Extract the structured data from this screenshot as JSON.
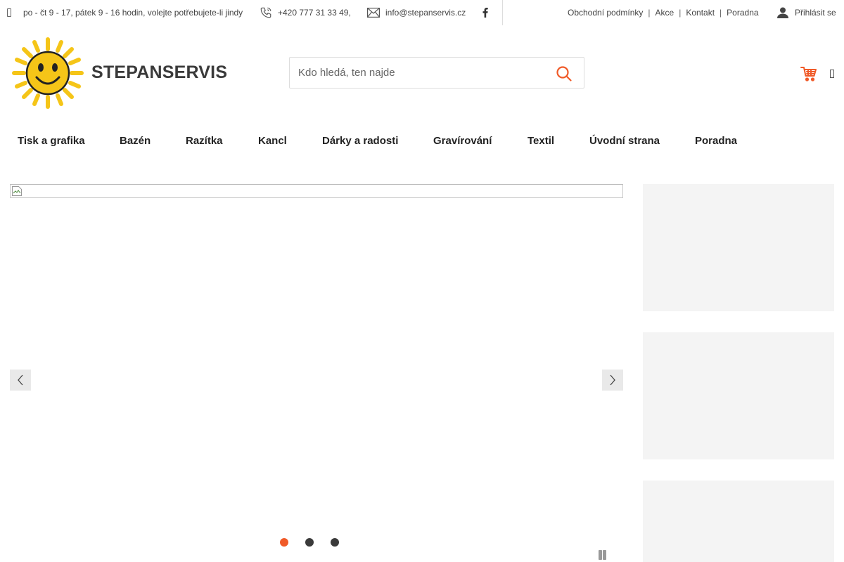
{
  "topbar": {
    "hours": "po - čt 9 - 17, pátek 9 - 16 hodin, volejte potřebujete-li jindy",
    "phone": "+420 777 31 33 49,",
    "email": "info@stepanservis.cz",
    "links": [
      "Obchodní podmínky",
      "Akce",
      "Kontakt",
      "Poradna"
    ],
    "login": "Přihlásit se"
  },
  "header": {
    "logo_text": "STEPANSERVIS",
    "search_placeholder": "Kdo hledá, ten najde"
  },
  "nav": {
    "items": [
      "Tisk a grafika",
      "Bazén",
      "Razítka",
      "Kancl",
      "Dárky a radosti",
      "Gravírování",
      "Textil",
      "Úvodní strana",
      "Poradna"
    ]
  },
  "slider": {
    "slide_count": 3,
    "active_index": 0
  },
  "colors": {
    "accent": "#f05a28",
    "sun": "#f5c518",
    "dot_inactive": "#3a3a3a",
    "banner_bg": "#f4f4f4"
  },
  "icons": {
    "hours": "clock-icon",
    "phone": "phone-icon",
    "email": "envelope-icon",
    "facebook": "facebook-icon",
    "login": "user-icon",
    "search": "search-icon",
    "cart": "cart-icon",
    "menu": "menu-icon"
  }
}
